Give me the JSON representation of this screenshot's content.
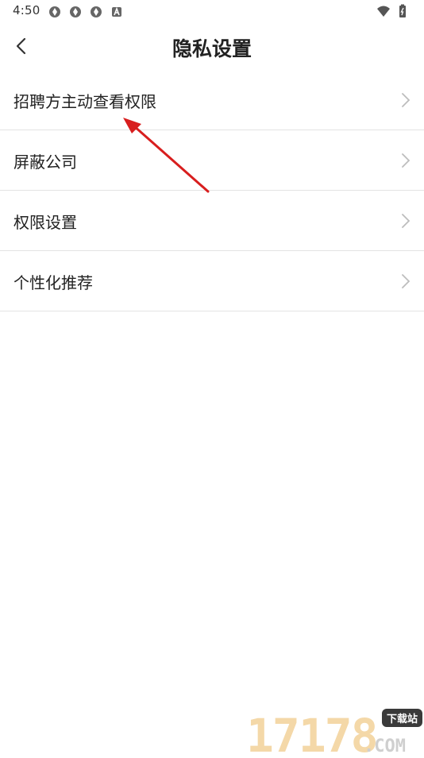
{
  "status_bar": {
    "time": "4:50",
    "left_icons": [
      "settings-gear-icon",
      "settings-gear-icon",
      "settings-gear-icon",
      "a-box-icon"
    ],
    "right_icons": [
      "wifi-icon",
      "battery-icon"
    ]
  },
  "nav": {
    "title": "隐私设置",
    "back_icon": "chevron-left-icon"
  },
  "list": {
    "items": [
      {
        "label": "招聘方主动查看权限"
      },
      {
        "label": "屏蔽公司"
      },
      {
        "label": "权限设置"
      },
      {
        "label": "个性化推荐"
      }
    ]
  },
  "colors": {
    "annotation_arrow": "#d81e1e",
    "divider": "#e3e3e3",
    "chevron": "#bdbdbd"
  },
  "watermark": {
    "logo_text": "17178.COM",
    "tag": "下载站"
  }
}
